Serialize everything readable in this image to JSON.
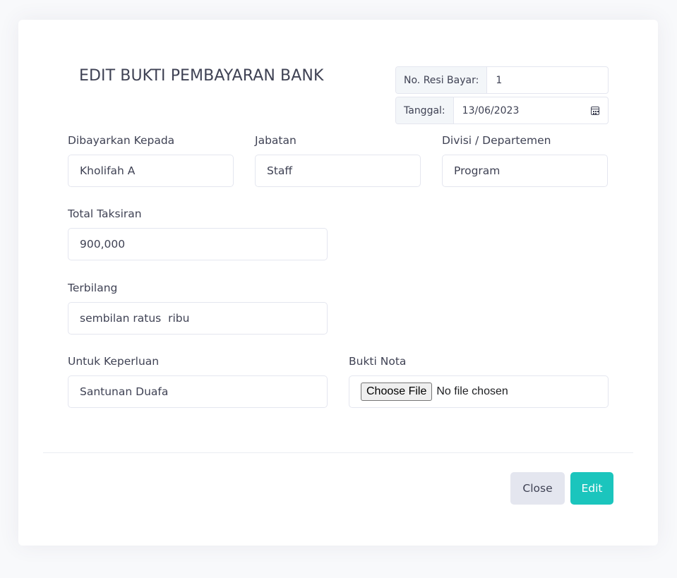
{
  "modal": {
    "title": "EDIT BUKTI PEMBAYARAN BANK",
    "resi": {
      "label": "No. Resi Bayar:",
      "value": "1"
    },
    "tanggal": {
      "label": "Tanggal:",
      "value": "13/06/2023",
      "icon": "calendar-icon"
    }
  },
  "form": {
    "dibayarkan_kepada": {
      "label": "Dibayarkan Kepada",
      "value": "Kholifah A"
    },
    "jabatan": {
      "label": "Jabatan",
      "value": "Staff"
    },
    "divisi": {
      "label": "Divisi / Departemen",
      "value": "Program"
    },
    "total_taksiran": {
      "label": "Total Taksiran",
      "value": "900,000"
    },
    "terbilang": {
      "label": "Terbilang",
      "value": "sembilan ratus  ribu"
    },
    "untuk_keperluan": {
      "label": "Untuk Keperluan",
      "value": "Santunan Duafa"
    },
    "bukti_nota": {
      "label": "Bukti Nota",
      "button": "Choose File",
      "status": "No file chosen"
    }
  },
  "footer": {
    "close_label": "Close",
    "edit_label": "Edit"
  },
  "colors": {
    "primary": "#1bc5bd",
    "secondary": "#e4e6ef",
    "text": "#3f4254",
    "border": "#e4e6ef"
  }
}
